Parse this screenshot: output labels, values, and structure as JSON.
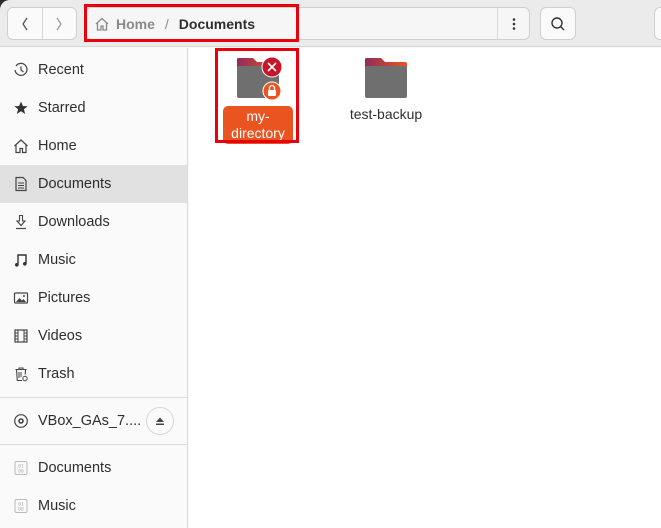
{
  "header": {
    "back_icon": "chevron-left-icon",
    "forward_icon": "chevron-right-icon",
    "breadcrumb": {
      "home_icon": "home-icon",
      "items": [
        "Home",
        "Documents"
      ],
      "separator": "/"
    },
    "path_menu_icon": "vertical-dots-icon",
    "search_icon": "search-icon"
  },
  "sidebar": {
    "places": [
      {
        "label": "Recent",
        "icon": "clock-icon"
      },
      {
        "label": "Starred",
        "icon": "star-icon"
      },
      {
        "label": "Home",
        "icon": "home-icon"
      },
      {
        "label": "Documents",
        "icon": "document-icon",
        "active": true
      },
      {
        "label": "Downloads",
        "icon": "download-icon"
      },
      {
        "label": "Music",
        "icon": "music-icon"
      },
      {
        "label": "Pictures",
        "icon": "picture-icon"
      },
      {
        "label": "Videos",
        "icon": "film-icon"
      },
      {
        "label": "Trash",
        "icon": "trash-icon"
      }
    ],
    "devices": [
      {
        "label": "VBox_GAs_7....",
        "icon": "disc-icon",
        "action_icon": "eject-icon"
      }
    ],
    "bookmarks": [
      {
        "label": "Documents",
        "icon": "binary-file-icon"
      },
      {
        "label": "Music",
        "icon": "binary-file-icon"
      }
    ]
  },
  "files": [
    {
      "name": "my-directory",
      "selected": true,
      "emblems": [
        "no-access-emblem-icon",
        "lock-emblem-icon"
      ]
    },
    {
      "name": "test-backup",
      "selected": false,
      "emblems": []
    }
  ],
  "colors": {
    "accent": "#e95420",
    "highlight_box": "#e8000d",
    "folder_body": "#6f6f6f",
    "folder_tab_start": "#8e2d5c",
    "folder_tab_end": "#e95420",
    "no_access_emblem": "#c7162b",
    "lock_emblem": "#e95420"
  }
}
